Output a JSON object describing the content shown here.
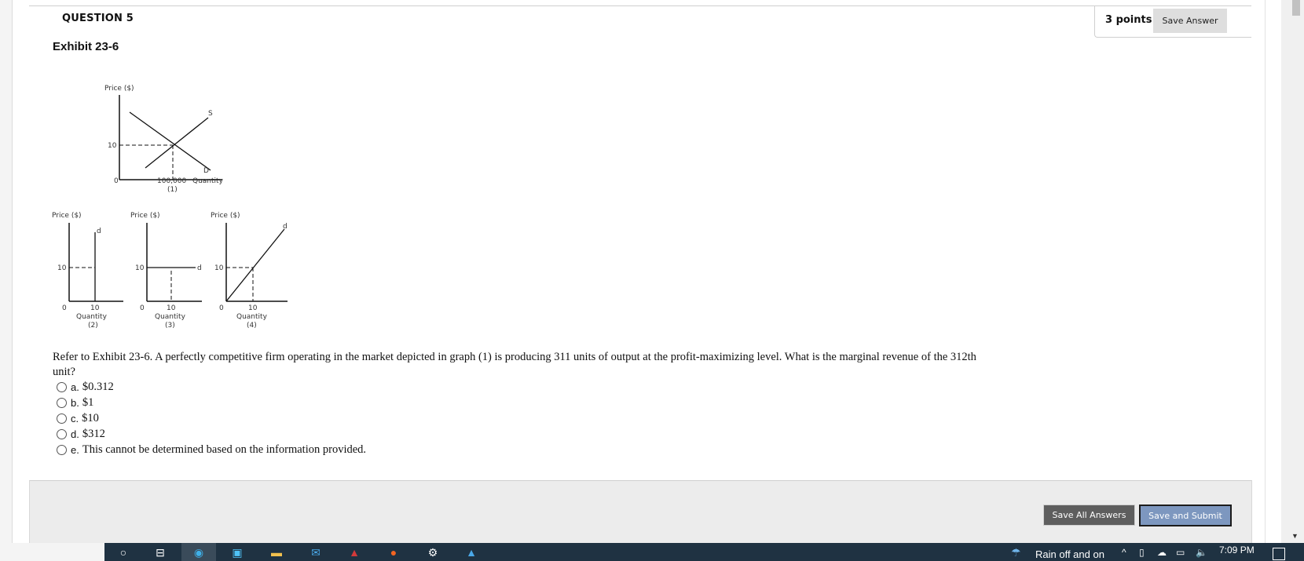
{
  "question": {
    "number_label": "QUESTION 5",
    "points_label": "3 points",
    "save_answer_label": "Save Answer",
    "exhibit_title": "Exhibit 23-6",
    "prompt": "Refer to Exhibit 23-6. A perfectly competitive firm operating in the market depicted in graph (1) is producing 311 units of output at the profit-maximizing level. What is the marginal revenue of the 312th unit?",
    "options": [
      {
        "letter": "a.",
        "text": "$0.312"
      },
      {
        "letter": "b.",
        "text": "$1"
      },
      {
        "letter": "c.",
        "text": "$10"
      },
      {
        "letter": "d.",
        "text": "$312"
      },
      {
        "letter": "e.",
        "text": "This cannot be determined based on the information provided."
      }
    ]
  },
  "exhibit": {
    "graph1": {
      "ylabel": "Price ($)",
      "y_tick": "10",
      "origin": "0",
      "x_tick": "100,000",
      "xlabel": "Quantity",
      "caption": "(1)",
      "supply_label": "S",
      "demand_label": "D"
    },
    "graph2": {
      "ylabel": "Price ($)",
      "y_tick": "10",
      "origin": "0",
      "x_tick": "10",
      "xlabel": "Quantity",
      "caption": "(2)",
      "curve_label": "d"
    },
    "graph3": {
      "ylabel": "Price ($)",
      "y_tick": "10",
      "origin": "0",
      "x_tick": "10",
      "xlabel": "Quantity",
      "caption": "(3)",
      "curve_label": "d"
    },
    "graph4": {
      "ylabel": "Price ($)",
      "y_tick": "10",
      "origin": "0",
      "x_tick": "10",
      "xlabel": "Quantity",
      "caption": "(4)",
      "curve_label": "d"
    }
  },
  "footer": {
    "save_all_label": "Save All Answers",
    "save_submit_label": "Save and Submit"
  },
  "taskbar": {
    "weather": "Rain off and on",
    "clock": "7:09 PM"
  },
  "colors": {
    "submit_button": "#7d97bf",
    "save_all_button": "#5e5e5e",
    "taskbar": "#1f3242"
  }
}
